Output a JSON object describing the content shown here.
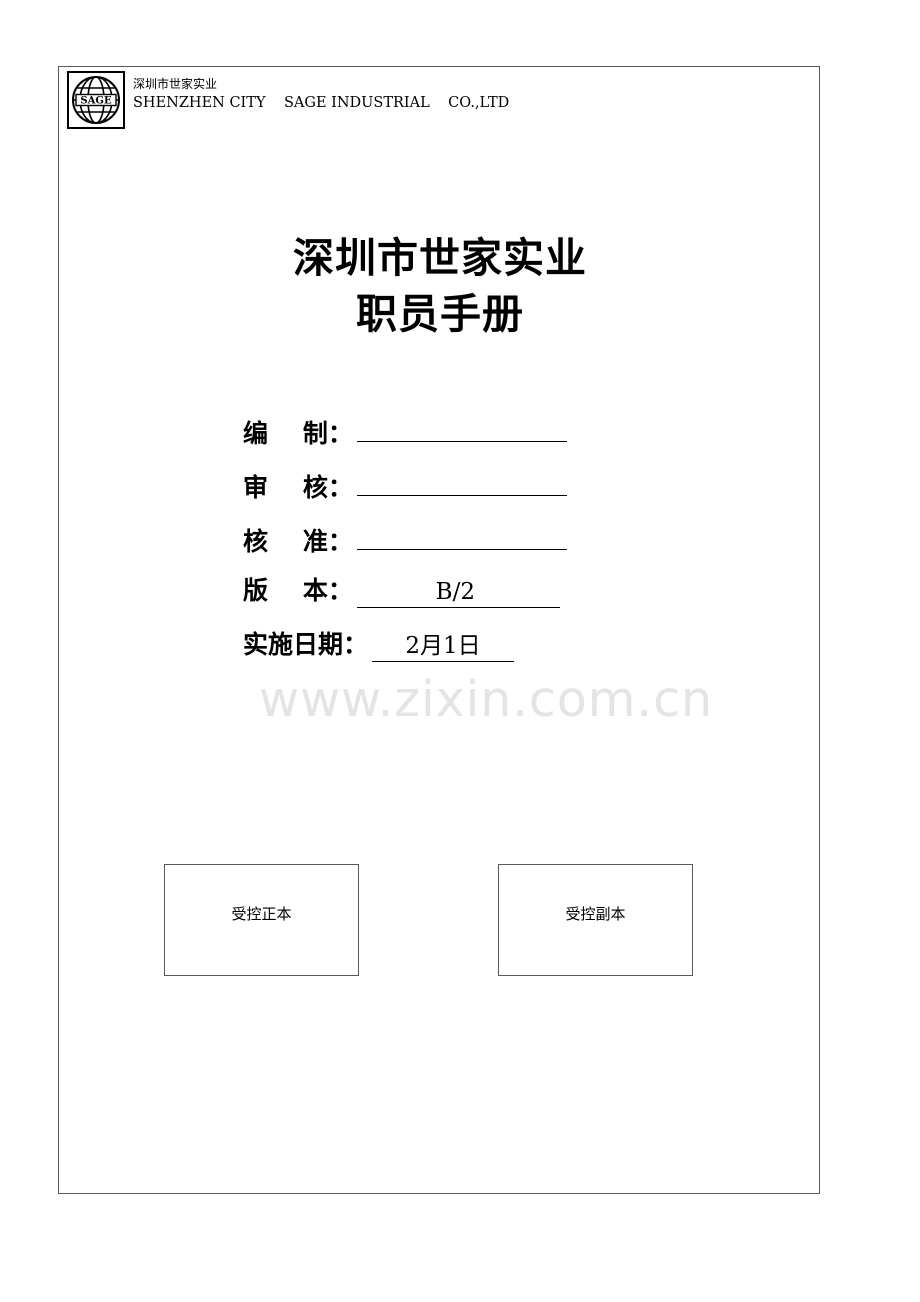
{
  "page": {
    "background_color": "#ffffff",
    "border_color": "#595959"
  },
  "letterhead": {
    "logo_icon": "globe-logo-icon",
    "logo_text": "SAGE",
    "company_cn": "深圳市世家实业",
    "company_en": "SHENZHEN CITY    SAGE INDUSTRIAL    CO.,LTD"
  },
  "title": {
    "line1": "深圳市世家实业",
    "line2": "职员手册"
  },
  "meta": {
    "rows": [
      {
        "label": "编    制：",
        "value": ""
      },
      {
        "label": "审    核：",
        "value": ""
      },
      {
        "label": "核    准：",
        "value": ""
      },
      {
        "label": "版    本：",
        "value": "B/2"
      },
      {
        "label": "实施日期：",
        "value": "2月1日"
      }
    ]
  },
  "copy_boxes": {
    "original_label": "受控正本",
    "duplicate_label": "受控副本"
  },
  "watermark": {
    "text": "www.zixin.com.cn",
    "color": "#e4e4e4"
  }
}
